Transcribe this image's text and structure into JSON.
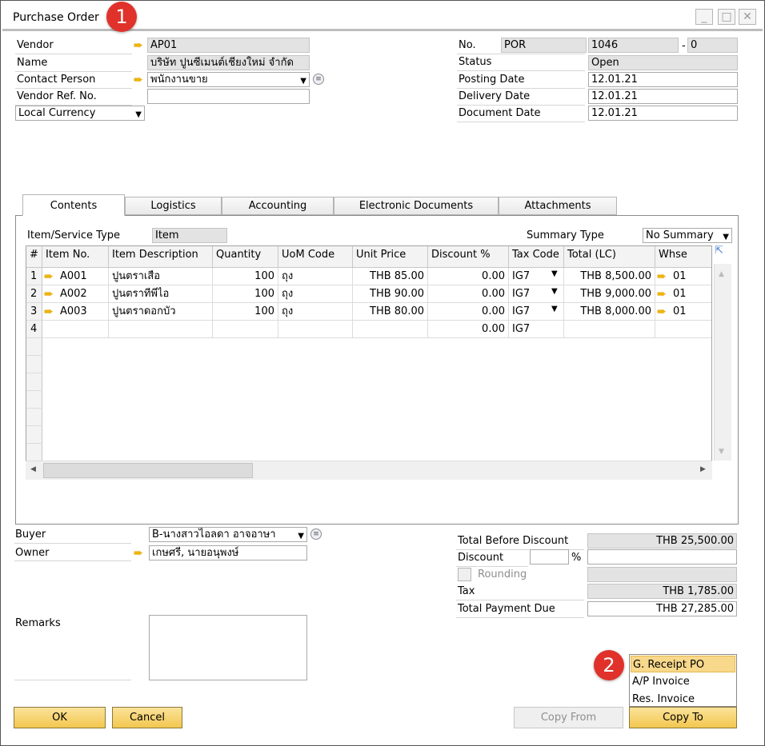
{
  "window": {
    "title": "Purchase Order",
    "minimize_glyph": "_",
    "maximize_glyph": "□",
    "close_glyph": "✕"
  },
  "badges": {
    "b1": "1",
    "b2": "2"
  },
  "header_left": {
    "vendor_label": "Vendor",
    "vendor_value": "AP01",
    "name_label": "Name",
    "name_value": "บริษัท ปูนซีเมนต์เชียงใหม่ จำกัด",
    "contact_label": "Contact Person",
    "contact_value": "พนักงานขาย",
    "vendor_ref_label": "Vendor Ref. No.",
    "vendor_ref_value": "",
    "currency_value": "Local Currency"
  },
  "header_right": {
    "no_label": "No.",
    "series_value": "POR",
    "number_value": "1046",
    "separator": "-",
    "suffix_value": "0",
    "status_label": "Status",
    "status_value": "Open",
    "posting_label": "Posting Date",
    "posting_value": "12.01.21",
    "delivery_label": "Delivery Date",
    "delivery_value": "12.01.21",
    "document_label": "Document Date",
    "document_value": "12.01.21"
  },
  "tabs": [
    "Contents",
    "Logistics",
    "Accounting",
    "Electronic Documents",
    "Attachments"
  ],
  "contents": {
    "item_type_label": "Item/Service Type",
    "item_type_value": "Item",
    "summary_label": "Summary Type",
    "summary_value": "No Summary"
  },
  "grid": {
    "columns": [
      "#",
      "Item No.",
      "Item Description",
      "Quantity",
      "UoM Code",
      "Unit Price",
      "Discount %",
      "Tax Code",
      "Total (LC)",
      "Whse"
    ],
    "rows": [
      {
        "n": "1",
        "item": "A001",
        "desc": "ปูนตราเสือ",
        "qty": "100",
        "uom": "ถุง",
        "price": "THB 85.00",
        "disc": "0.00",
        "tax": "IG7",
        "total": "THB 8,500.00",
        "whse": "01"
      },
      {
        "n": "2",
        "item": "A002",
        "desc": "ปูนตราทีพีไอ",
        "qty": "100",
        "uom": "ถุง",
        "price": "THB 90.00",
        "disc": "0.00",
        "tax": "IG7",
        "total": "THB 9,000.00",
        "whse": "01"
      },
      {
        "n": "3",
        "item": "A003",
        "desc": "ปูนตราดอกบัว",
        "qty": "100",
        "uom": "ถุง",
        "price": "THB 80.00",
        "disc": "0.00",
        "tax": "IG7",
        "total": "THB 8,000.00",
        "whse": "01"
      },
      {
        "n": "4",
        "item": "",
        "desc": "",
        "qty": "",
        "uom": "",
        "price": "",
        "disc": "0.00",
        "tax": "IG7",
        "total": "",
        "whse": ""
      }
    ]
  },
  "footer_left": {
    "buyer_label": "Buyer",
    "buyer_value": "B-นางสาวไอลดา อาจอาษา",
    "owner_label": "Owner",
    "owner_value": "เกษศรี, นายอนุพงษ์",
    "remarks_label": "Remarks"
  },
  "totals": {
    "before_label": "Total Before Discount",
    "before_value": "THB 25,500.00",
    "discount_label": "Discount",
    "percent_sign": "%",
    "rounding_label": "Rounding",
    "tax_label": "Tax",
    "tax_value": "THB 1,785.00",
    "due_label": "Total Payment Due",
    "due_value": "THB 27,285.00"
  },
  "copy_to_menu": [
    "G. Receipt PO",
    "A/P Invoice",
    "Res. Invoice"
  ],
  "buttons": {
    "ok": "OK",
    "cancel": "Cancel",
    "copy_from": "Copy From",
    "copy_to": "Copy To"
  },
  "colors": {
    "badge": "#e0322b",
    "button": "#f3c74f",
    "menu_highlight": "#f8d88b",
    "link_arrow": "#f0b400"
  }
}
